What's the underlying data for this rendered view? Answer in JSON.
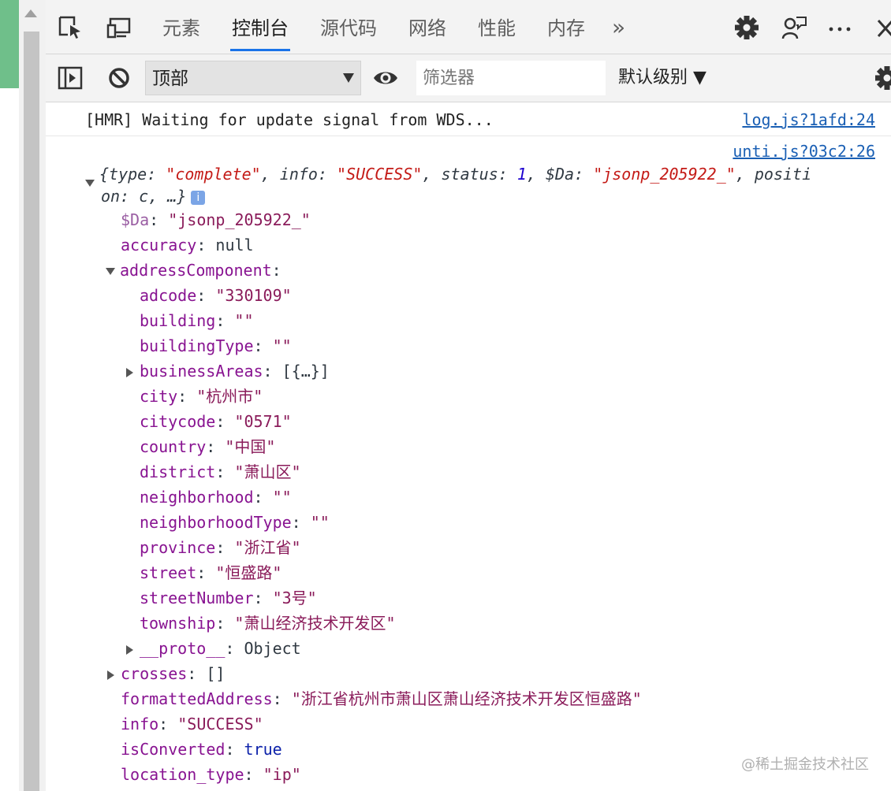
{
  "devtools": {
    "tabs": [
      {
        "label": "元素"
      },
      {
        "label": "控制台"
      },
      {
        "label": "源代码"
      },
      {
        "label": "网络"
      },
      {
        "label": "性能"
      },
      {
        "label": "内存"
      }
    ],
    "more_tabs": "»"
  },
  "toolbar": {
    "context": "顶部",
    "filter_placeholder": "筛选器",
    "levels": "默认级别 ▼"
  },
  "console": {
    "messages": [
      {
        "text": "[HMR] Waiting for update signal from WDS...",
        "source": "log.js?1afd:24"
      }
    ],
    "object_source": "unti.js?03c2:26",
    "summary": {
      "line1_prefix": "{type: ",
      "type_val": "\"complete\"",
      "info_key": ", info: ",
      "info_val": "\"SUCCESS\"",
      "status_key": ", status: ",
      "status_val": "1",
      "da_key": ", $Da: ",
      "da_val": "\"jsonp_205922_\"",
      "pos_key": ", positi",
      "line2": "on: c, …}",
      "badge": "i"
    },
    "props": {
      "da_key": "$Da",
      "da_val": "\"jsonp_205922_\"",
      "accuracy_key": "accuracy",
      "accuracy_val": "null",
      "address_key": "addressComponent",
      "address": [
        {
          "key": "adcode",
          "val": "\"330109\""
        },
        {
          "key": "building",
          "val": "\"\""
        },
        {
          "key": "buildingType",
          "val": "\"\""
        },
        {
          "key": "businessAreas",
          "val": "[{…}]"
        },
        {
          "key": "city",
          "val": "\"杭州市\""
        },
        {
          "key": "citycode",
          "val": "\"0571\""
        },
        {
          "key": "country",
          "val": "\"中国\""
        },
        {
          "key": "district",
          "val": "\"萧山区\""
        },
        {
          "key": "neighborhood",
          "val": "\"\""
        },
        {
          "key": "neighborhoodType",
          "val": "\"\""
        },
        {
          "key": "province",
          "val": "\"浙江省\""
        },
        {
          "key": "street",
          "val": "\"恒盛路\""
        },
        {
          "key": "streetNumber",
          "val": "\"3号\""
        },
        {
          "key": "township",
          "val": "\"萧山经济技术开发区\""
        },
        {
          "key": "__proto__",
          "val": "Object"
        }
      ],
      "crosses_key": "crosses",
      "crosses_val": "[]",
      "formatted_key": "formattedAddress",
      "formatted_val": "\"浙江省杭州市萧山区萧山经济技术开发区恒盛路\"",
      "info_key": "info",
      "info_val": "\"SUCCESS\"",
      "converted_key": "isConverted",
      "converted_val": "true",
      "location_key": "location_type",
      "location_val": "\"ip\""
    }
  },
  "watermark": "@稀土掘金技术社区"
}
